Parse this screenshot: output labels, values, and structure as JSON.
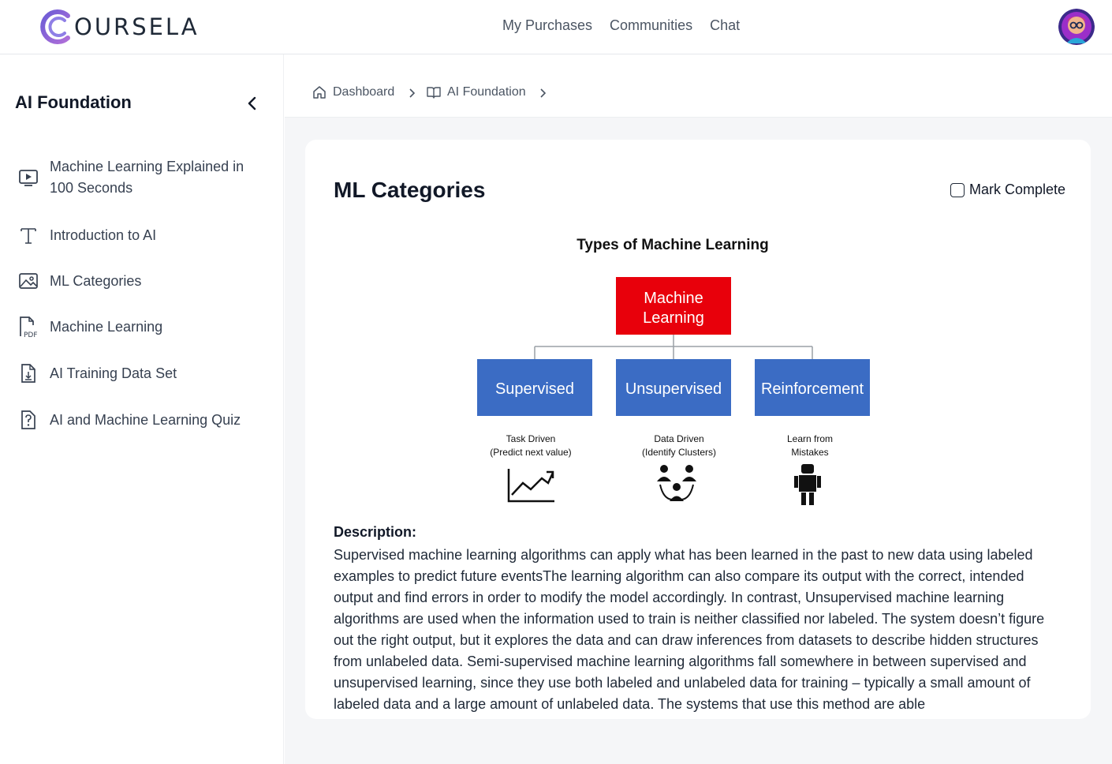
{
  "header": {
    "logo_text": "OURSELA",
    "nav": [
      "My Purchases",
      "Communities",
      "Chat"
    ]
  },
  "sidebar": {
    "title": "AI Foundation",
    "items": [
      {
        "label": "Machine Learning Explained in 100 Seconds",
        "icon": "video-icon"
      },
      {
        "label": "Introduction to AI",
        "icon": "text-icon"
      },
      {
        "label": "ML Categories",
        "icon": "image-icon"
      },
      {
        "label": "Machine Learning",
        "icon": "pdf-icon"
      },
      {
        "label": "AI Training Data Set",
        "icon": "download-file-icon"
      },
      {
        "label": "AI and Machine Learning Quiz",
        "icon": "quiz-icon"
      }
    ]
  },
  "breadcrumb": {
    "items": [
      "Dashboard",
      "AI Foundation"
    ]
  },
  "lesson": {
    "title": "ML Categories",
    "mark_complete_label": "Mark Complete",
    "mark_complete_checked": false,
    "description_heading": "Description:",
    "description": "Supervised machine learning algorithms can apply what has been learned in the past to new data using labeled examples to predict future eventsThe learning algorithm can also compare its output with the correct, intended output and find errors in order to modify the model accordingly. In contrast, Unsupervised machine learning algorithms are used when the information used to train is neither classified nor labeled. The system doesn’t figure out the right output, but it explores the data and can draw inferences from datasets to describe hidden structures from unlabeled data. Semi-supervised machine learning algorithms fall somewhere in between supervised and unsupervised learning, since they use both labeled and unlabeled data for training – typically a small amount of labeled data and a large amount of unlabeled data. The systems that use this method are able"
  },
  "diagram": {
    "title": "Types of Machine Learning",
    "root": [
      "Machine",
      "Learning"
    ],
    "branches": [
      {
        "label": "Supervised",
        "caption": [
          "Task Driven",
          "(Predict next value)"
        ],
        "icon": "trend-chart-icon"
      },
      {
        "label": "Unsupervised",
        "caption": [
          "Data Driven",
          "(Identify Clusters)"
        ],
        "icon": "people-cluster-icon"
      },
      {
        "label": "Reinforcement",
        "caption": [
          "Learn from",
          "Mistakes"
        ],
        "icon": "robot-icon"
      }
    ],
    "colors": {
      "root": "#e8000b",
      "branch": "#3b6cc4"
    }
  }
}
